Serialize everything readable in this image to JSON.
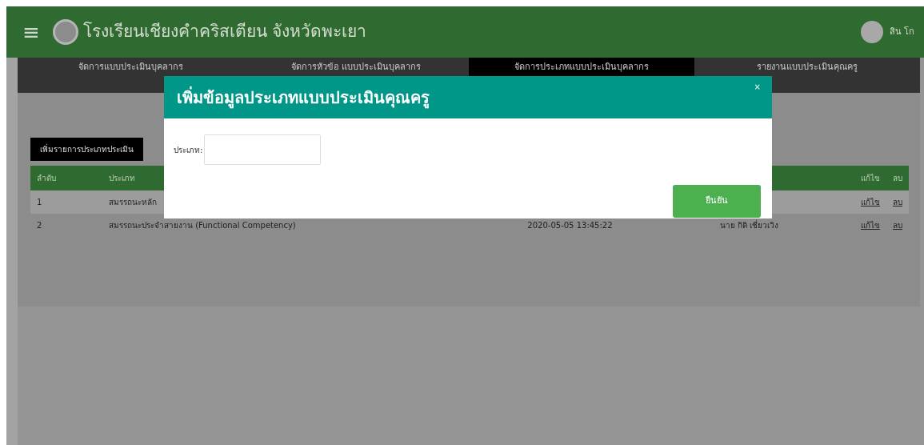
{
  "header": {
    "menu_icon": "≡",
    "title": "โรงเรียนเชียงคำคริสเตียน จังหวัดพะเยา",
    "user_name": "สิน โก"
  },
  "tabs": [
    {
      "label": "จัดการแบบประเมินบุคลากร",
      "selected": false
    },
    {
      "label": "จัดการหัวข้อ แบบประเมินบุคลากร",
      "selected": false
    },
    {
      "label": "จัดการประเภทแบบประเมินบุคลากร",
      "selected": true
    },
    {
      "label": "รายงานแบบประเมินคุณครู",
      "selected": false
    }
  ],
  "add_button": "เพิ่มรายการประเภทประเมิน",
  "table": {
    "columns": [
      "ลำดับ",
      "ประเภท",
      "",
      "",
      "",
      "แก้ไข",
      "ลบ"
    ],
    "rows": [
      {
        "cells": [
          "1",
          "สมรรถนะหลัก",
          "",
          "",
          ""
        ],
        "edit": "แก้ไข",
        "delete": "ลบ",
        "highlighted": true
      },
      {
        "cells": [
          "2",
          "สมรรถนะประจำสายงาน (Functional Competency)",
          "",
          "2020-05-05 13:45:22",
          "นาย กิติ เชี่ยวเวิง"
        ],
        "edit": "แก้ไข",
        "delete": "ลบ",
        "highlighted": false
      }
    ]
  },
  "modal": {
    "title": "เพิ่มข้อมูลประเภทแบบประเมินคุณครู",
    "close": "×",
    "field_label": "ประเภท:",
    "confirm": "ยืนยัน"
  }
}
